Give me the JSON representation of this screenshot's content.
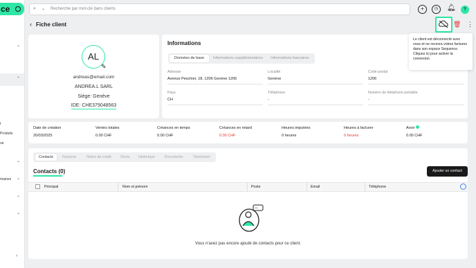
{
  "app": {
    "logo_text": "ce"
  },
  "sidebar": {
    "items": [
      "t",
      "Produits",
      "ue",
      "maines"
    ]
  },
  "search": {
    "placeholder": "Recherche par mot-clé dans clients"
  },
  "topbar": {
    "avatar_letter": "?"
  },
  "page": {
    "title": "Fiche client"
  },
  "tooltip": {
    "text": "Le client est déconnecté avec vous et ne recevra votres factures dans son espace Sequence. Cliquez ici pour activer la connexion."
  },
  "profile": {
    "initials": "AL",
    "email": "andreas@email.com",
    "company": "ANDREA.L SARL",
    "siege": "Siège: Genève",
    "ide": "IDE: CHE379048563"
  },
  "info": {
    "title": "Informations",
    "tabs": [
      "Données de base",
      "Informations supplémentaires",
      "Informations bancaires"
    ],
    "fields": [
      {
        "label": "Adresse",
        "value": "Avenue Peschier, 18, 1206  Genève 1206"
      },
      {
        "label": "Localité",
        "value": "Genève"
      },
      {
        "label": "Code postal",
        "value": "1206"
      },
      {
        "label": "Pays",
        "value": "CH"
      },
      {
        "label": "Téléphone",
        "value": "-"
      },
      {
        "label": "Numéro de téléphone portable",
        "value": "-"
      }
    ]
  },
  "stats": [
    {
      "label": "Date de création",
      "value": "20/03/2025",
      "red": false
    },
    {
      "label": "Ventes totales",
      "value": "0.00 CHF",
      "red": false
    },
    {
      "label": "Créances en temps",
      "value": "0.00 CHF",
      "red": false
    },
    {
      "label": "Créances en retard",
      "value": "0.00 CHF",
      "red": true
    },
    {
      "label": "Heures imputées",
      "value": "0 heures",
      "red": false
    },
    {
      "label": "Heures à facturer",
      "value": "0 heures",
      "red": true
    },
    {
      "label": "Avoir",
      "value": "0.00 CHF",
      "red": false
    }
  ],
  "contacts": {
    "tabs": [
      "Contacts",
      "Factures",
      "Notes de crédit",
      "Devis",
      "Historique",
      "Documents",
      "Timesheet"
    ],
    "title": "Contacts (0)",
    "add_label": "Ajouter un contact",
    "columns": [
      "Principal",
      "Nom et prénom",
      "Poste",
      "Email",
      "Téléphone"
    ],
    "empty_text": "Vous n'avez pas encore ajouté de contacts pour ce client."
  },
  "colors": {
    "accent": "#2ee6a6",
    "danger": "#e53935",
    "dark": "#1a1a1a"
  }
}
